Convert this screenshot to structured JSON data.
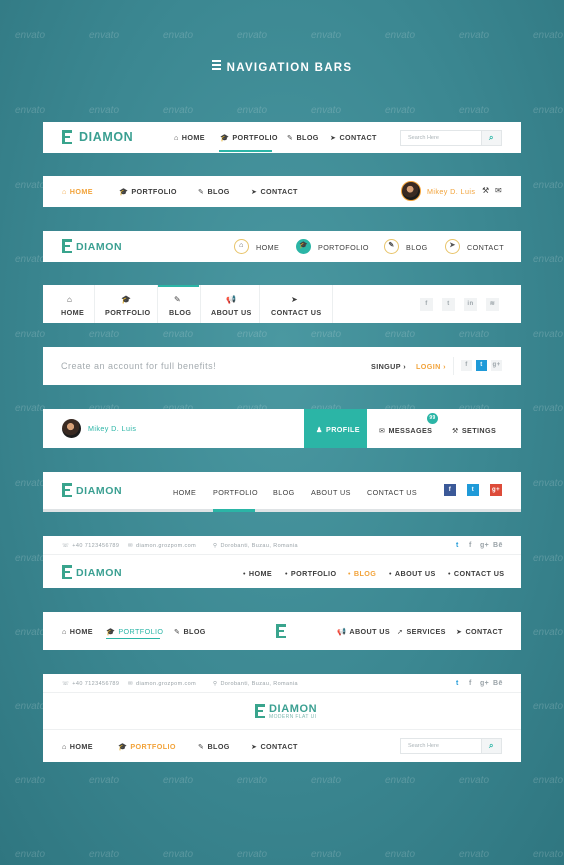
{
  "page_title": "NAVIGATION BARS",
  "watermark": "envato",
  "brand": "DIAMON",
  "bar1": {
    "items": [
      {
        "icon": "home-icon",
        "label": "HOME"
      },
      {
        "icon": "graduation-cap-icon",
        "label": "PORTFOLIO"
      },
      {
        "icon": "pencil-icon",
        "label": "BLOG"
      },
      {
        "icon": "send-icon",
        "label": "CONTACT"
      }
    ],
    "search_placeholder": "Search Here"
  },
  "bar2": {
    "items": [
      {
        "icon": "home-icon",
        "label": "HOME"
      },
      {
        "icon": "graduation-cap-icon",
        "label": "PORTFOLIO"
      },
      {
        "icon": "pencil-icon",
        "label": "BLOG"
      },
      {
        "icon": "send-icon",
        "label": "CONTACT"
      }
    ],
    "user_name": "Mikey D. Luis"
  },
  "bar3": {
    "items": [
      {
        "icon": "home-icon",
        "label": "HOME"
      },
      {
        "icon": "graduation-cap-icon",
        "label": "PORTOFOLIO"
      },
      {
        "icon": "pencil-icon",
        "label": "BLOG"
      },
      {
        "icon": "send-icon",
        "label": "CONTACT"
      }
    ]
  },
  "bar4": {
    "items": [
      {
        "icon": "home-icon",
        "label": "HOME"
      },
      {
        "icon": "graduation-cap-icon",
        "label": "PORTFOLIO"
      },
      {
        "icon": "pencil-icon",
        "label": "BLOG"
      },
      {
        "icon": "bullhorn-icon",
        "label": "ABOUT US"
      },
      {
        "icon": "send-icon",
        "label": "CONTACT US"
      }
    ],
    "social": [
      "f",
      "t",
      "in"
    ]
  },
  "bar5": {
    "prompt": "Create an account for full benefits!",
    "signup": "SINGUP",
    "login": "LOGIN",
    "social": [
      "f",
      "t",
      "g+"
    ]
  },
  "bar6": {
    "user_name": "Mikey D. Luis",
    "tabs": [
      {
        "icon": "user-icon",
        "label": "PROFILE"
      },
      {
        "icon": "envelope-icon",
        "label": "MESSAGES"
      },
      {
        "icon": "wrench-icon",
        "label": "SETINGS"
      }
    ],
    "badge": "99"
  },
  "bar7": {
    "items": [
      "HOME",
      "PORTFOLIO",
      "BLOG",
      "ABOUT US",
      "CONTACT US"
    ],
    "social": [
      "f",
      "t",
      "g+"
    ]
  },
  "bar8": {
    "phone": "+40 7123456789",
    "email": "diamon.grozpom.com",
    "address": "Dorobanti, Buzau, Romania",
    "items": [
      "HOME",
      "PORTFOLIO",
      "BLOG",
      "ABOUT US",
      "CONTACT US"
    ],
    "social": [
      "t",
      "f",
      "g+",
      "Bē"
    ]
  },
  "bar9": {
    "left": [
      {
        "icon": "home-icon",
        "label": "HOME"
      },
      {
        "icon": "graduation-cap-icon",
        "label": "PORTFOLIO"
      },
      {
        "icon": "pencil-icon",
        "label": "BLOG"
      }
    ],
    "right": [
      {
        "icon": "bullhorn-icon",
        "label": "ABOUT US"
      },
      {
        "icon": "rocket-icon",
        "label": "SERVICES"
      },
      {
        "icon": "send-icon",
        "label": "CONTACT"
      }
    ]
  },
  "bar10": {
    "phone": "+40 7123456789",
    "email": "diamon.grozpom.com",
    "address": "Dorobanti, Buzau, Romania",
    "social": [
      "t",
      "f",
      "g+",
      "Bē"
    ],
    "tagline": "MODERN FLAT UI",
    "items": [
      {
        "icon": "home-icon",
        "label": "HOME"
      },
      {
        "icon": "graduation-cap-icon",
        "label": "PORTFOLIO"
      },
      {
        "icon": "pencil-icon",
        "label": "BLOG"
      },
      {
        "icon": "send-icon",
        "label": "CONTACT"
      }
    ],
    "search_placeholder": "Search Here"
  },
  "colors": {
    "background": "#3d8a94",
    "accent_teal": "#2bb5a6",
    "accent_orange": "#f2a33a",
    "logo": "#3a9f91"
  }
}
